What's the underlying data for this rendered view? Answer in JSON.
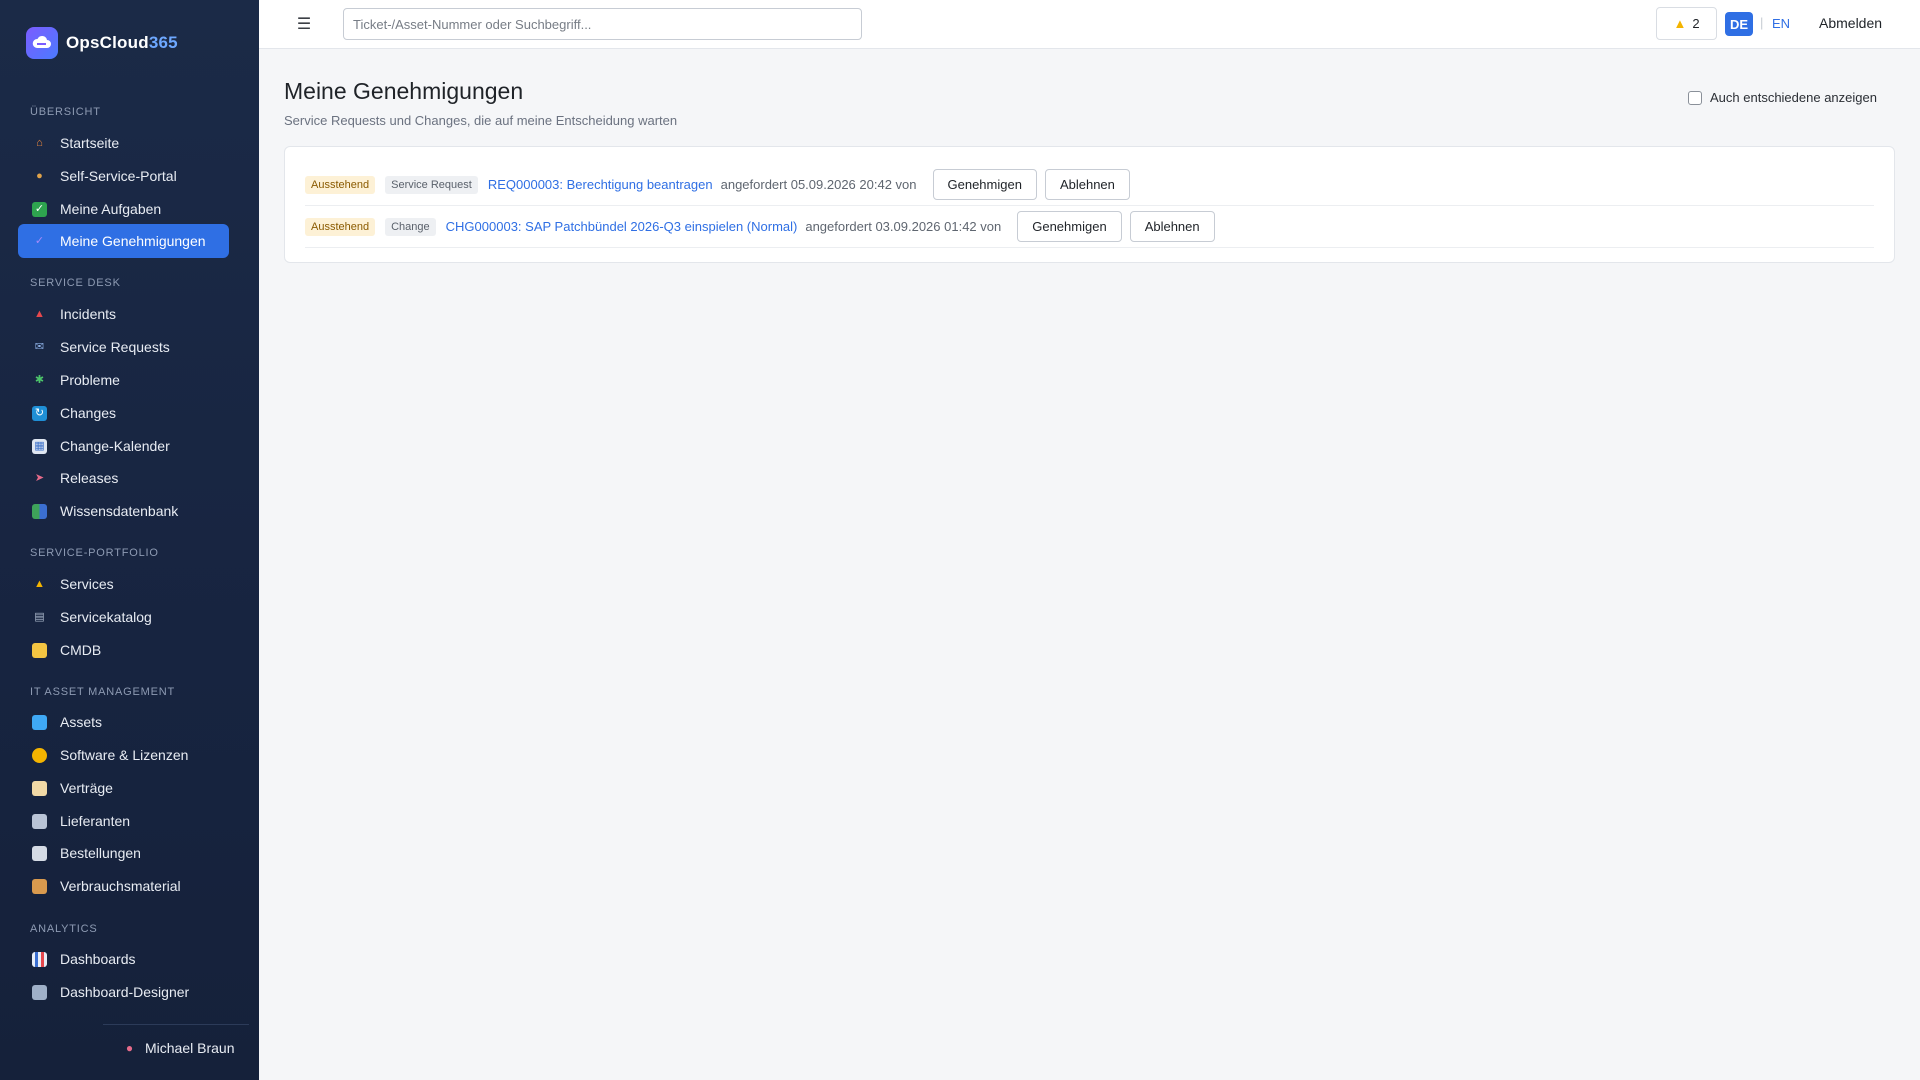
{
  "app": {
    "name_main": "OpsCloud",
    "name_accent": "365"
  },
  "sidebar": {
    "sections": [
      {
        "label": "ÜBERSICHT",
        "items": [
          {
            "label": "Startseite",
            "icon": "house-icon"
          },
          {
            "label": "Self-Service-Portal",
            "icon": "person-icon"
          },
          {
            "label": "Meine Aufgaben",
            "icon": "check-box-icon"
          },
          {
            "label": "Meine Genehmigungen",
            "icon": "checkmark-icon",
            "active": true
          }
        ]
      },
      {
        "label": "SERVICE DESK",
        "items": [
          {
            "label": "Incidents",
            "icon": "siren-icon"
          },
          {
            "label": "Service Requests",
            "icon": "inbox-icon"
          },
          {
            "label": "Probleme",
            "icon": "puzzle-icon"
          },
          {
            "label": "Changes",
            "icon": "cycle-icon"
          },
          {
            "label": "Change-Kalender",
            "icon": "calendar-icon"
          },
          {
            "label": "Releases",
            "icon": "rocket-icon"
          },
          {
            "label": "Wissensdatenbank",
            "icon": "books-icon"
          }
        ]
      },
      {
        "label": "SERVICE-PORTFOLIO",
        "items": [
          {
            "label": "Services",
            "icon": "service-bell-icon"
          },
          {
            "label": "Servicekatalog",
            "icon": "catalog-icon"
          },
          {
            "label": "CMDB",
            "icon": "folder-icon"
          }
        ]
      },
      {
        "label": "IT ASSET MANAGEMENT",
        "items": [
          {
            "label": "Assets",
            "icon": "laptop-icon"
          },
          {
            "label": "Software & Lizenzen",
            "icon": "disc-icon"
          },
          {
            "label": "Verträge",
            "icon": "scroll-icon"
          },
          {
            "label": "Lieferanten",
            "icon": "building-icon"
          },
          {
            "label": "Bestellungen",
            "icon": "receipt-icon"
          },
          {
            "label": "Verbrauchsmaterial",
            "icon": "package-icon"
          }
        ]
      },
      {
        "label": "ANALYTICS",
        "items": [
          {
            "label": "Dashboards",
            "icon": "bar-chart-icon"
          },
          {
            "label": "Dashboard-Designer",
            "icon": "grid-icon"
          }
        ]
      }
    ],
    "user": {
      "name": "Michael Braun",
      "icon": "user-pin-icon"
    }
  },
  "topbar": {
    "search_placeholder": "Ticket-/Asset-Nummer oder Suchbegriff...",
    "notification_count": "2",
    "lang_active": "DE",
    "lang_separator": "|",
    "lang_other": "EN",
    "logout_label": "Abmelden"
  },
  "main": {
    "title": "Meine Genehmigungen",
    "subtitle": "Service Requests und Changes, die auf meine Entscheidung warten",
    "show_decided_label": "Auch entschiedene anzeigen",
    "approvals": [
      {
        "status": "Ausstehend",
        "type": "Service Request",
        "title": "REQ000003: Berechtigung beantragen",
        "meta": "angefordert 05.09.2026 20:42 von",
        "approve_label": "Genehmigen",
        "reject_label": "Ablehnen"
      },
      {
        "status": "Ausstehend",
        "type": "Change",
        "title": "CHG000003: SAP Patchbündel 2026-Q3 einspielen (Normal)",
        "meta": "angefordert 03.09.2026 01:42 von",
        "approve_label": "Genehmigen",
        "reject_label": "Ablehnen"
      }
    ]
  },
  "colors": {
    "accent": "#2f6fe4",
    "sidebar_bg": "#1b2a47",
    "badge_pending_bg": "#fdf1d6"
  }
}
